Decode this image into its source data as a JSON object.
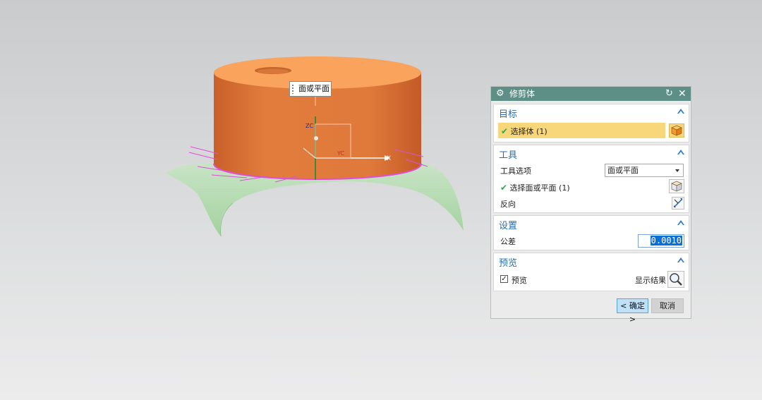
{
  "viewport": {
    "tooltip": "面或平面",
    "axis_labels": {
      "z": "ZC",
      "y": "YC",
      "x": "X"
    }
  },
  "dialog": {
    "title": "修剪体",
    "title_icon": "gear-icon",
    "target": {
      "title": "目标",
      "select_body": "选择体 (1)"
    },
    "tool": {
      "title": "工具",
      "option_label": "工具选项",
      "option_value": "面或平面",
      "select_face": "选择面或平面 (1)",
      "reverse_label": "反向"
    },
    "settings": {
      "title": "设置",
      "tolerance_label": "公差",
      "tolerance_value": "0.0010"
    },
    "preview": {
      "title": "预览",
      "checkbox_label": "预览",
      "checked": true,
      "show_result_label": "显示结果"
    },
    "ok_label": "< 确定 >",
    "cancel_label": "取消"
  },
  "colors": {
    "titlebar": "#5e8f86",
    "section_title": "#1f6fb5",
    "selection_row": "#f8d67a",
    "cylinder_side": "#e07b3c",
    "cylinder_top": "#f9a35c",
    "sheet_surface": "#a9d9a6"
  }
}
